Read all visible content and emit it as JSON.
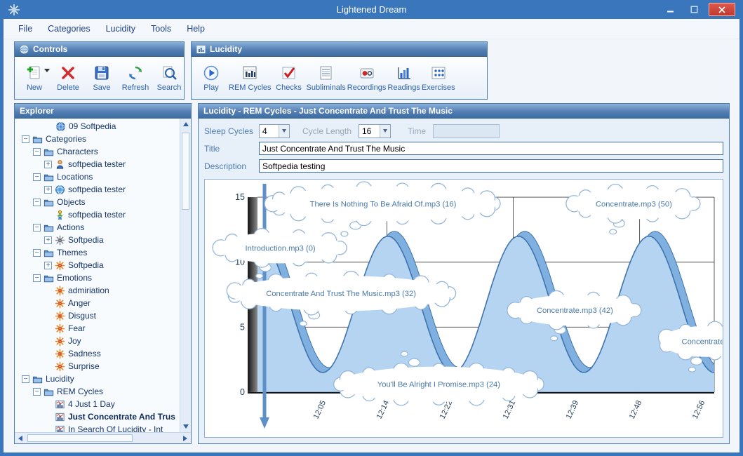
{
  "window": {
    "title": "Lightened Dream"
  },
  "colors": {
    "titlebar": "#3a76bb",
    "header_gradient_top": "#8ab1da",
    "header_gradient_bottom": "#3c6da1",
    "close_button": "#d24b3e",
    "toolbar_label": "#2b5ea9"
  },
  "menu": {
    "items": [
      "File",
      "Categories",
      "Lucidity",
      "Tools",
      "Help"
    ]
  },
  "toolbars": {
    "controls": {
      "title": "Controls",
      "buttons": [
        {
          "label": "New",
          "icon": "new-page"
        },
        {
          "label": "Delete",
          "icon": "delete-x"
        },
        {
          "label": "Save",
          "icon": "save-disk"
        },
        {
          "label": "Refresh",
          "icon": "refresh-arrows"
        },
        {
          "label": "Search",
          "icon": "search-magnifier"
        }
      ]
    },
    "lucidity": {
      "title": "Lucidity",
      "buttons": [
        {
          "label": "Play",
          "icon": "play"
        },
        {
          "label": "REM Cycles",
          "icon": "rem-chart"
        },
        {
          "label": "Checks",
          "icon": "check-mark"
        },
        {
          "label": "Subliminals",
          "icon": "subliminal-list"
        },
        {
          "label": "Recordings",
          "icon": "recording"
        },
        {
          "label": "Readings",
          "icon": "readings-bars"
        },
        {
          "label": "Exercises",
          "icon": "exercises-grid"
        }
      ]
    }
  },
  "explorer": {
    "title": "Explorer",
    "tree": [
      {
        "label": "09 Softpedia",
        "level": 3,
        "icon": "sphere",
        "exp": "none"
      },
      {
        "label": "Categories",
        "level": 0,
        "icon": "folder",
        "exp": "open"
      },
      {
        "label": "Characters",
        "level": 1,
        "icon": "folder",
        "exp": "open"
      },
      {
        "label": "softpedia tester",
        "level": 2,
        "icon": "person",
        "exp": "closed"
      },
      {
        "label": "Locations",
        "level": 1,
        "icon": "folder",
        "exp": "open"
      },
      {
        "label": "softpedia tester",
        "level": 2,
        "icon": "globe",
        "exp": "closed"
      },
      {
        "label": "Objects",
        "level": 1,
        "icon": "folder",
        "exp": "open"
      },
      {
        "label": "softpedia tester",
        "level": 2,
        "icon": "figure",
        "exp": "leaf"
      },
      {
        "label": "Actions",
        "level": 1,
        "icon": "folder",
        "exp": "open"
      },
      {
        "label": "Softpedia",
        "level": 2,
        "icon": "burst-gray",
        "exp": "closed"
      },
      {
        "label": "Themes",
        "level": 1,
        "icon": "folder",
        "exp": "open"
      },
      {
        "label": "Softpedia",
        "level": 2,
        "icon": "burst",
        "exp": "closed"
      },
      {
        "label": "Emotions",
        "level": 1,
        "icon": "folder",
        "exp": "open"
      },
      {
        "label": "admiriation",
        "level": 2,
        "icon": "burst",
        "exp": "leaf"
      },
      {
        "label": "Anger",
        "level": 2,
        "icon": "burst",
        "exp": "leaf"
      },
      {
        "label": "Disgust",
        "level": 2,
        "icon": "burst",
        "exp": "leaf"
      },
      {
        "label": "Fear",
        "level": 2,
        "icon": "burst",
        "exp": "leaf"
      },
      {
        "label": "Joy",
        "level": 2,
        "icon": "burst",
        "exp": "leaf"
      },
      {
        "label": "Sadness",
        "level": 2,
        "icon": "burst",
        "exp": "leaf"
      },
      {
        "label": "Surprise",
        "level": 2,
        "icon": "burst",
        "exp": "leaf"
      },
      {
        "label": "Lucidity",
        "level": 0,
        "icon": "folder",
        "exp": "open"
      },
      {
        "label": "REM Cycles",
        "level": 1,
        "icon": "folder",
        "exp": "open"
      },
      {
        "label": "4 Just 1 Day",
        "level": 2,
        "icon": "chart",
        "exp": "leaf"
      },
      {
        "label": "Just Concentrate And Trus",
        "level": 2,
        "icon": "chart",
        "exp": "leaf",
        "selected": true
      },
      {
        "label": "In Search Of Lucidity - Int",
        "level": 2,
        "icon": "chart",
        "exp": "leaf"
      }
    ]
  },
  "main": {
    "title": "Lucidity - REM Cycles - Just Concentrate And Trust The Music",
    "form": {
      "sleep_cycles": {
        "label": "Sleep Cycles",
        "value": "4"
      },
      "cycle_length": {
        "label": "Cycle Length",
        "value": "16"
      },
      "time": {
        "label": "Time",
        "value": ""
      },
      "title": {
        "label": "Title",
        "value": "Just Concentrate And Trust The Music"
      },
      "description": {
        "label": "Description",
        "value": "Softpedia testing"
      }
    }
  },
  "chart_data": {
    "type": "area",
    "x_tick_labels": [
      "12:05",
      "12:14",
      "12:22",
      "12:31",
      "12:39",
      "12:48",
      "12:56"
    ],
    "y_ticks": [
      0,
      5,
      10,
      15
    ],
    "ylim": [
      0,
      15
    ],
    "sleep_cycles": 4,
    "wave": {
      "baseline": 6.75,
      "amplitude": 5.25,
      "cycles": 3.5,
      "samples": 160
    },
    "annotations": [
      {
        "label": "Introduction.mp3 (0)",
        "t": 0.05,
        "value": 11.1
      },
      {
        "label": "There Is Nothing To Be Afraid Of.mp3 (16)",
        "t": 0.275,
        "value": 14.5
      },
      {
        "label": "Concentrate And Trust The Music.mp3 (32)",
        "t": 0.183,
        "value": 7.6
      },
      {
        "label": "You'll Be Alright I Promise.mp3 (24)",
        "t": 0.397,
        "value": 0.6
      },
      {
        "label": "Concentrate.mp3 (42)",
        "t": 0.695,
        "value": 6.3
      },
      {
        "label": "Concentrate.mp3 (50)",
        "t": 0.824,
        "value": 14.5
      },
      {
        "label": "Concentrate.m",
        "t": 0.985,
        "value": 3.9
      }
    ],
    "colors": {
      "fill": "#b5d4f2",
      "edge": "#3f74ad",
      "ribbon": "#7fb0e0",
      "cloud_stroke": "#97b7da",
      "cloud_text": "#4a7aa8",
      "arrow": "#5e90c8"
    }
  }
}
